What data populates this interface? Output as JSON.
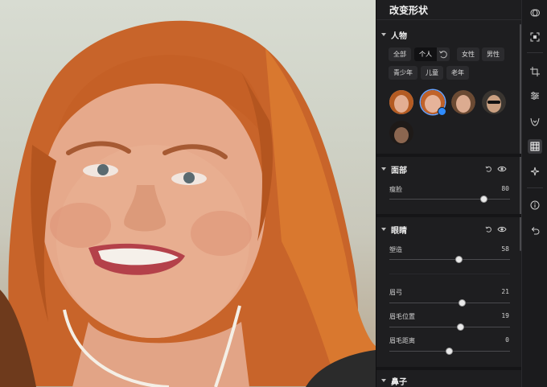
{
  "panel": {
    "title": "改变形状",
    "people": {
      "header": "人物",
      "filters_row1": [
        "全部",
        "个人",
        "女性",
        "男性"
      ],
      "filters_row2": [
        "青少年",
        "儿童",
        "老年"
      ],
      "selected_filter": "个人",
      "faces": [
        {
          "name": "face-1",
          "skin": "#d8a184",
          "hair": "#b45b22"
        },
        {
          "name": "face-2",
          "skin": "#e0b098",
          "hair": "#c0622a",
          "selected": true
        },
        {
          "name": "face-3",
          "skin": "#d9a88c",
          "hair": "#6b4a33"
        },
        {
          "name": "face-4",
          "skin": "#c99a7c",
          "hair": "#2a2622"
        },
        {
          "name": "face-5",
          "skin": "#8b6650",
          "hair": "#1e1a18"
        }
      ]
    },
    "face_section": {
      "header": "面部",
      "sliders": [
        {
          "label": "瘦脸",
          "value": 80
        }
      ]
    },
    "eyes_section": {
      "header": "眼睛",
      "sliders": [
        {
          "label": "塑造",
          "value": 58
        },
        {
          "label": "眉弓",
          "value": 21
        },
        {
          "label": "眉毛位置",
          "value": 19
        },
        {
          "label": "眉毛距离",
          "value": 0
        }
      ]
    },
    "nose_section": {
      "header": "鼻子"
    }
  },
  "toolbar": {
    "items": [
      "layers-icon",
      "select-subject-icon",
      "crop-icon",
      "adjust-sliders-icon",
      "face-retouch-icon",
      "reshape-icon",
      "sparkle-icon",
      "info-icon",
      "undo-icon"
    ],
    "active": "reshape-icon"
  },
  "colors": {
    "accent": "#2f8cff",
    "panel_bg": "#1e1e20",
    "hair": "#c8642a"
  }
}
